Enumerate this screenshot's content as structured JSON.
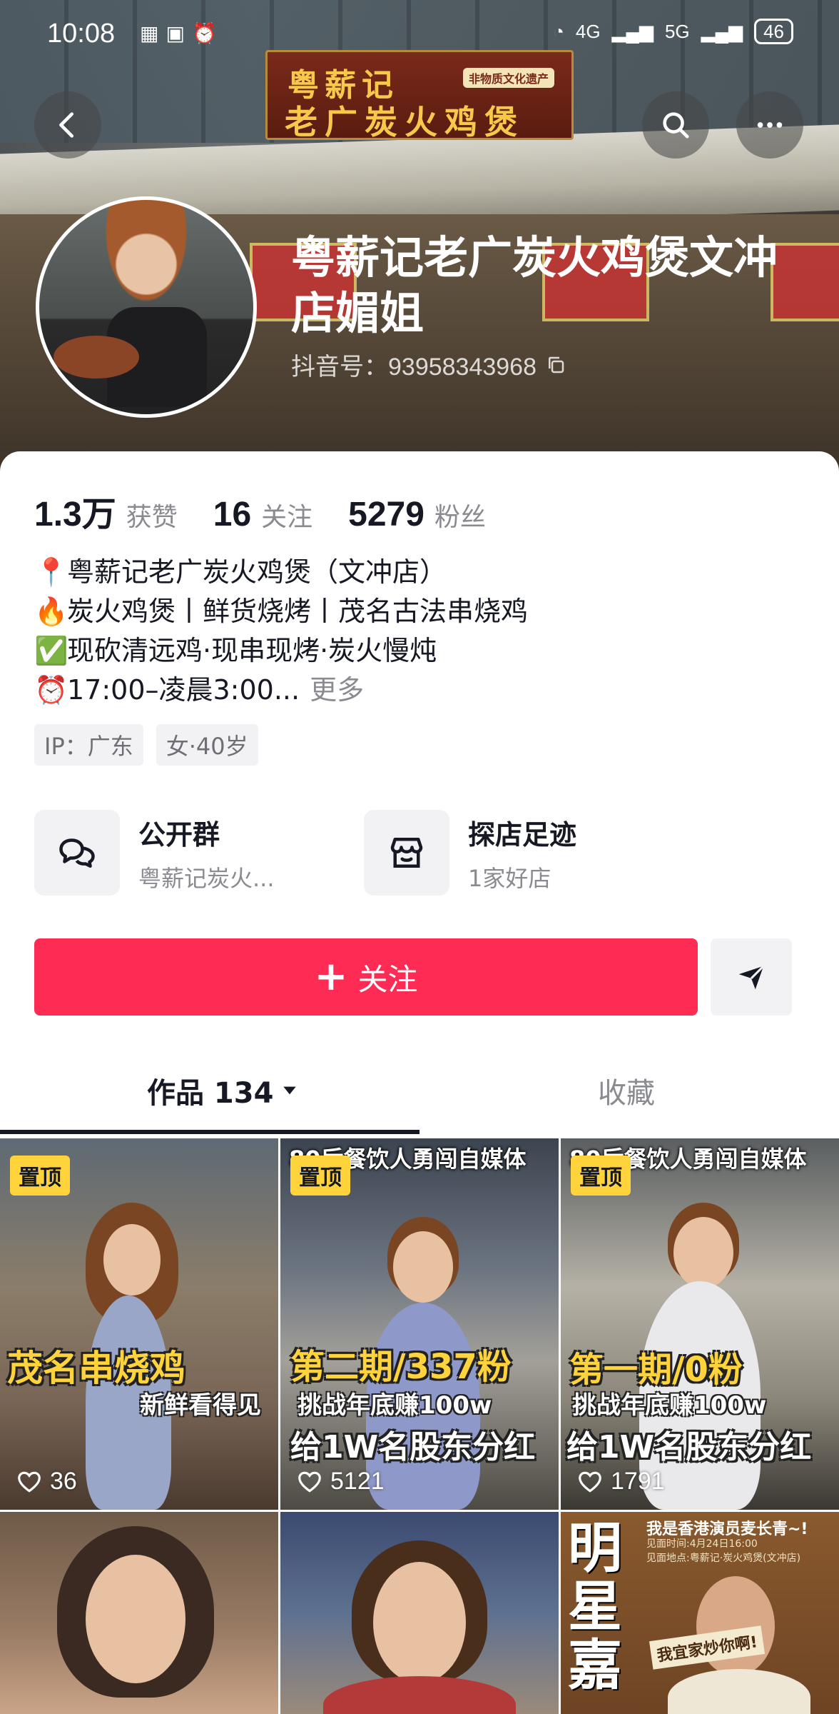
{
  "status_bar": {
    "time": "10:08",
    "network_4g": "4G",
    "network_5g": "5G",
    "battery": "46"
  },
  "banner": {
    "sign_line1": "粤薪记",
    "sign_line2": "老广炭火鸡煲",
    "sign_badge": "非物质文化遗产"
  },
  "profile": {
    "name": "粤薪记老广炭火鸡煲文冲店媚姐",
    "douyin_id": "抖音号：93958343968"
  },
  "stats": [
    {
      "num": "1.3万",
      "label": "获赞"
    },
    {
      "num": "16",
      "label": "关注"
    },
    {
      "num": "5279",
      "label": "粉丝"
    }
  ],
  "bio": {
    "lines": [
      {
        "icon": "pin-icon",
        "emoji": "📍",
        "text": "粤薪记老广炭火鸡煲（文冲店）"
      },
      {
        "icon": "fire-icon",
        "emoji": "🔥",
        "text": "炭火鸡煲丨鲜货烧烤丨茂名古法串烧鸡"
      },
      {
        "icon": "check-icon",
        "emoji": "✅",
        "text": "现砍清远鸡·现串现烤·炭火慢炖"
      },
      {
        "icon": "alarm-icon",
        "emoji": "⏰",
        "text": "17:00–凌晨3:00..."
      }
    ],
    "more": "更多"
  },
  "tags": [
    "IP：广东",
    "女·40岁"
  ],
  "features": {
    "group": {
      "title": "公开群",
      "sub": "粤薪记炭火..."
    },
    "visits": {
      "title": "探店足迹",
      "sub": "1家好店"
    }
  },
  "actions": {
    "follow_label": "关注"
  },
  "tabs": {
    "works": "作品 134",
    "favorites": "收藏"
  },
  "videos": [
    {
      "pinned": "置顶",
      "top_caption": "",
      "big_caption": "茂名串烧鸡",
      "mid_caption": "新鲜看得见",
      "low_caption": "",
      "likes": "36"
    },
    {
      "pinned": "置顶",
      "top_caption": "80后餐饮人勇闯自媒体",
      "big_caption": "第二期/337粉",
      "mid_caption": "挑战年底赚100w",
      "low_caption": "给1W名股东分红",
      "likes": "5121"
    },
    {
      "pinned": "置顶",
      "top_caption": "80后餐饮人勇闯自媒体",
      "big_caption": "第一期/0粉",
      "mid_caption": "挑战年底赚100w",
      "low_caption": "给1W名股东分红",
      "likes": "1791"
    },
    {
      "pinned": "",
      "likes": ""
    },
    {
      "pinned": "",
      "likes": ""
    },
    {
      "pinned": "",
      "poster_text": "明星嘉",
      "poster_head": "我是香港演员麦长青~!",
      "poster_sub1": "见面时间:4月24日16:00",
      "poster_sub2": "见面地点:粤薪记·炭火鸡煲(文冲店)",
      "poster_stamp": "我宜家炒你啊!"
    }
  ],
  "colors": {
    "follow": "#fe2c55",
    "pin_badge": "#ffd33b",
    "text_primary": "#161823",
    "text_secondary": "#8a8b91"
  }
}
